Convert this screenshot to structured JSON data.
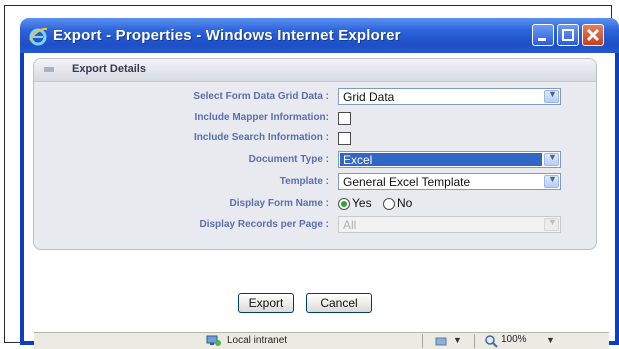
{
  "window": {
    "title": "Export - Properties - Windows Internet Explorer",
    "colors": {
      "titlebar": "#2d63db",
      "close": "#c3401c",
      "label": "#5a6fae",
      "selection": "#3166c5",
      "radio_selected": "#29a929"
    }
  },
  "panel": {
    "title": "Export Details"
  },
  "form": {
    "select_form_data": {
      "label": "Select Form Data Grid Data :",
      "value": "Grid Data"
    },
    "include_mapper": {
      "label": "Include Mapper Information:",
      "checked": false
    },
    "include_search": {
      "label": "Include Search Information :",
      "checked": false
    },
    "document_type": {
      "label": "Document Type :",
      "value": "Excel"
    },
    "template": {
      "label": "Template :",
      "value": "General Excel Template"
    },
    "display_form_name": {
      "label": "Display Form Name :",
      "options": [
        "Yes",
        "No"
      ],
      "selected": "Yes"
    },
    "records_per_page": {
      "label": "Display Records per Page :",
      "value": "All",
      "disabled": true
    }
  },
  "buttons": {
    "export": "Export",
    "cancel": "Cancel"
  },
  "statusbar": {
    "zone": "Local intranet",
    "zoom": "100%",
    "icons": [
      "network-zone-icon",
      "protected-mode-icon",
      "zoom-icon"
    ]
  }
}
